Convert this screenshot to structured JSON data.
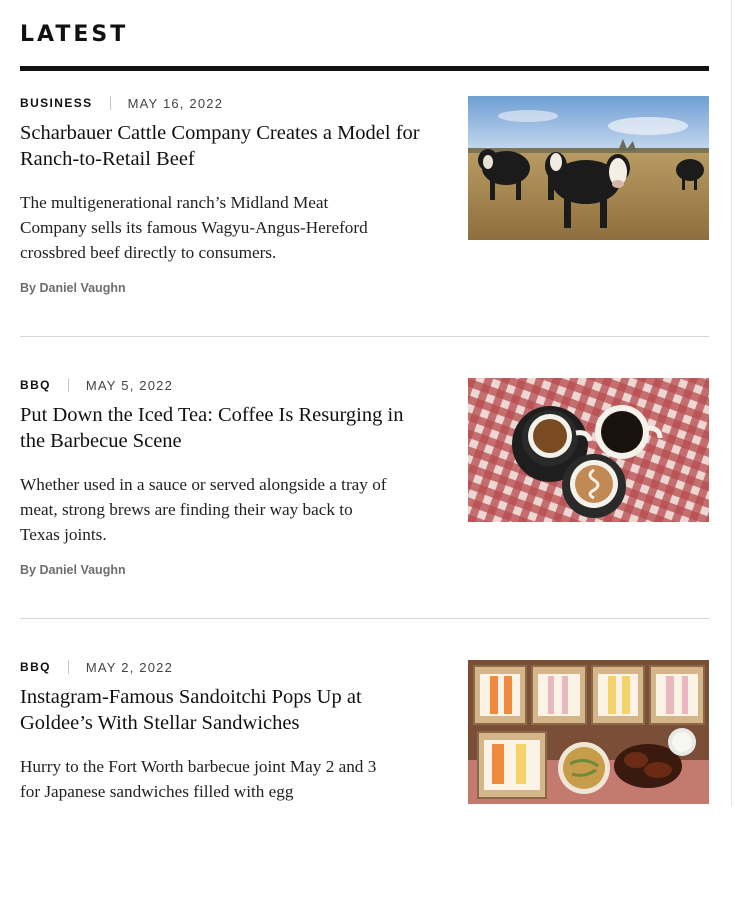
{
  "section": {
    "title": "LATEST"
  },
  "articles": [
    {
      "category": "BUSINESS",
      "date": "MAY 16, 2022",
      "headline": "Scharbauer Cattle Company Creates a Model for Ranch-to-Retail Beef",
      "dek": "The multigenerational ranch’s Midland Meat Company sells its famous Wagyu-Angus-Hereford crossbred beef directly to consumers.",
      "byline_prefix": "By",
      "author": "Daniel Vaughn",
      "image_icon": "cattle-photo"
    },
    {
      "category": "BBQ",
      "date": "MAY 5, 2022",
      "headline": "Put Down the Iced Tea: Coffee Is Resurging in the Barbecue Scene",
      "dek": "Whether used in a sauce or served alongside a tray of meat, strong brews are finding their way back to Texas joints.",
      "byline_prefix": "By",
      "author": "Daniel Vaughn",
      "image_icon": "coffee-cups-photo"
    },
    {
      "category": "BBQ",
      "date": "MAY 2, 2022",
      "headline": "Instagram-Famous Sandoitchi Pops Up at Goldee’s With Stellar Sandwiches",
      "dek": "Hurry to the Fort Worth barbecue joint May 2 and 3 for Japanese sandwiches filled with egg",
      "image_icon": "sandwich-boxes-photo"
    }
  ],
  "colors": {
    "text": "#111111",
    "byline": "#6e6e6e",
    "rule": "#d6d6d6",
    "heavy_rule": "#111111"
  }
}
